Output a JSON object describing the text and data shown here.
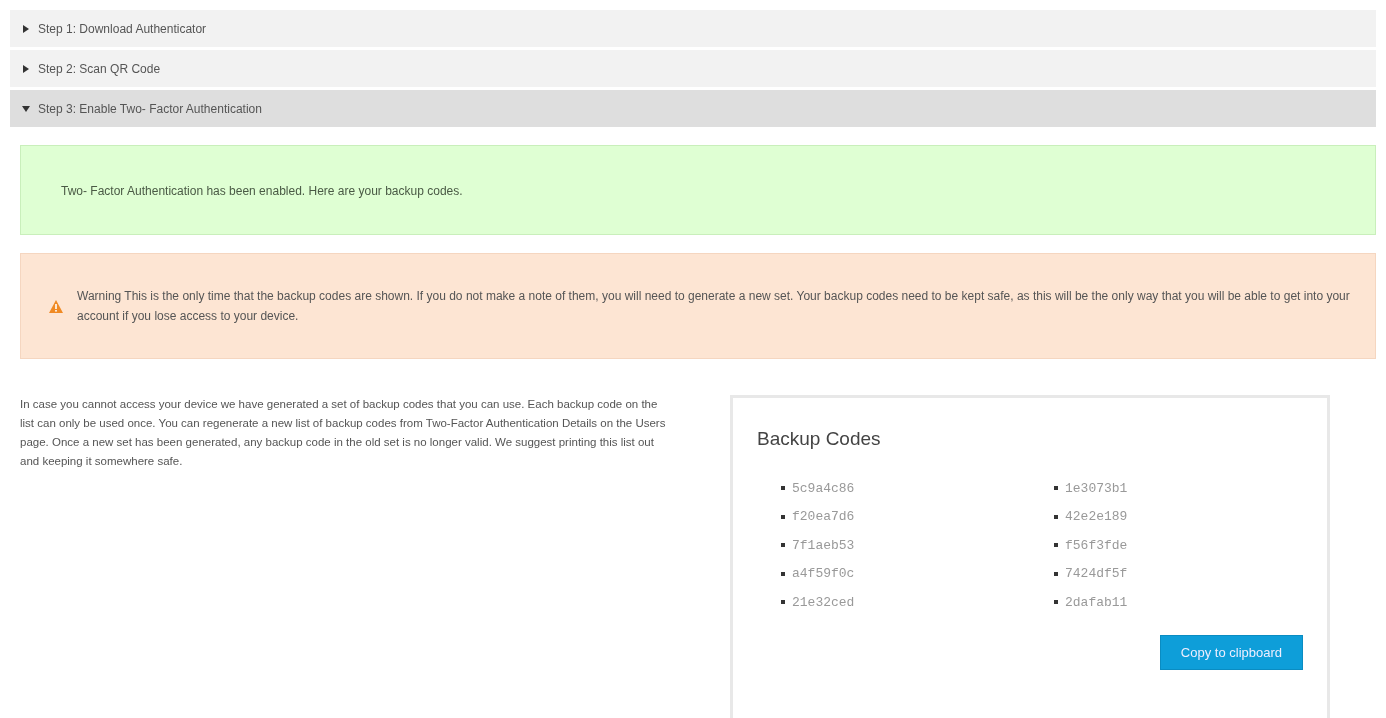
{
  "steps": [
    {
      "label": "Step 1: Download Authenticator",
      "expanded": false
    },
    {
      "label": "Step 2: Scan QR Code",
      "expanded": false
    },
    {
      "label": "Step 3: Enable Two- Factor Authentication",
      "expanded": true
    }
  ],
  "success_message": "Two- Factor Authentication has been enabled.  Here are your backup codes.",
  "warning_message": "Warning This is the only time that the backup codes are shown. If you do not make a note of them, you will need to generate a new set. Your backup codes need to be kept safe, as this will be the only way that you will be able to get into your account if you lose access to your device.",
  "info_text": "In case you cannot access your device we have generated a set of backup codes that you can use. Each backup code on the list can only be used once. You can regenerate a new list of backup codes from Two-Factor Authentication Details on the Users page. Once a new set has been generated, any backup code in the old set is no longer valid. We suggest printing this list out and keeping it somewhere safe.",
  "backup_codes": {
    "title": "Backup Codes",
    "columns": [
      [
        "5c9a4c86",
        "f20ea7d6",
        "7f1aeb53",
        "a4f59f0c",
        "21e32ced"
      ],
      [
        "1e3073b1",
        "42e2e189",
        "f56f3fde",
        "7424df5f",
        "2dafab11"
      ]
    ],
    "button": "Copy to clipboard"
  }
}
